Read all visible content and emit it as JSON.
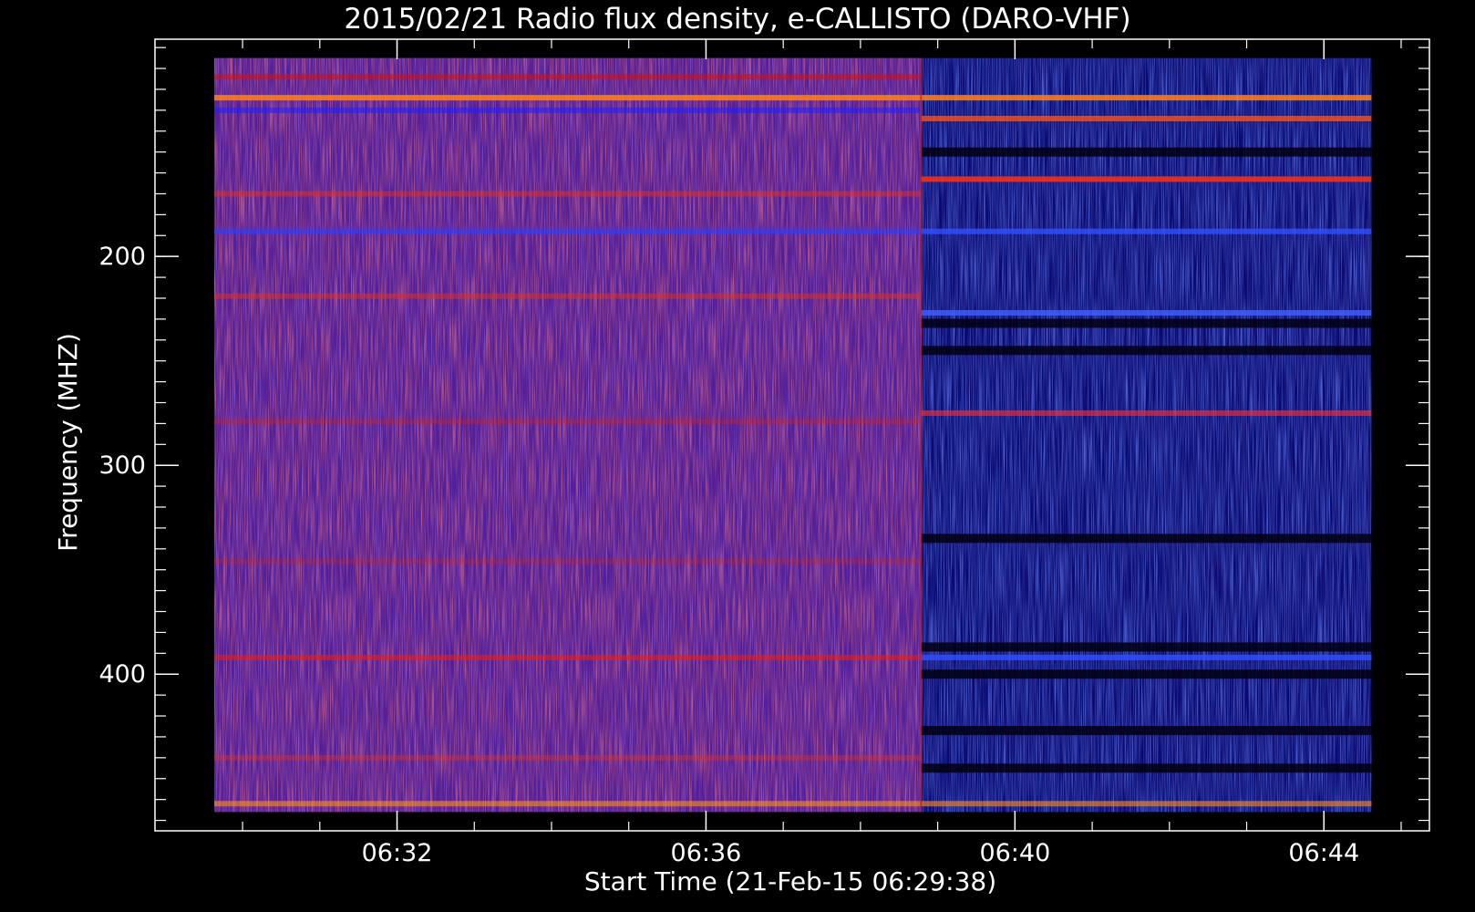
{
  "chart_data": {
    "type": "heatmap",
    "title": "2015/02/21  Radio flux density, e-CALLISTO (DARO-VHF)",
    "xlabel": "Start Time (21-Feb-15 06:29:38)",
    "ylabel": "Frequency (MHZ)",
    "x_ticks": [
      "06:32",
      "06:36",
      "06:40",
      "06:44"
    ],
    "x_tick_minutes": [
      2.367,
      6.367,
      10.367,
      14.367
    ],
    "y_ticks": [
      200,
      300,
      400
    ],
    "xlim_minutes": [
      -0.767,
      15.733
    ],
    "ylim": [
      475,
      96
    ],
    "data_extent": {
      "time_minutes": [
        0,
        14.983
      ],
      "frequency_mhz": [
        105,
        466
      ],
      "change_point_minutes": 9.15
    },
    "segments": [
      {
        "time_minutes": [
          0,
          9.15
        ],
        "background": "#52209a"
      },
      {
        "time_minutes": [
          9.15,
          14.983
        ],
        "background": "#0a0a70"
      }
    ],
    "bands": [
      {
        "freq": 114,
        "t": [
          0,
          9.15
        ],
        "color": "#d01010",
        "opacity": 0.55
      },
      {
        "freq": 124,
        "t": [
          0,
          14.983
        ],
        "color": "#ff8020",
        "opacity": 0.85
      },
      {
        "freq": 130,
        "t": [
          0,
          9.15
        ],
        "color": "#2020ff",
        "opacity": 0.6
      },
      {
        "freq": 134,
        "t": [
          9.15,
          14.983
        ],
        "color": "#ff5010",
        "opacity": 0.8
      },
      {
        "freq": 163,
        "t": [
          9.15,
          14.983
        ],
        "color": "#ff3010",
        "opacity": 0.85
      },
      {
        "freq": 170,
        "t": [
          0,
          9.15
        ],
        "color": "#e03020",
        "opacity": 0.5
      },
      {
        "freq": 188,
        "t": [
          0,
          9.15
        ],
        "color": "#2a40ff",
        "opacity": 0.6
      },
      {
        "freq": 188,
        "t": [
          9.15,
          14.983
        ],
        "color": "#3050ff",
        "opacity": 0.8
      },
      {
        "freq": 219,
        "t": [
          0,
          9.15
        ],
        "color": "#e03020",
        "opacity": 0.5
      },
      {
        "freq": 227,
        "t": [
          9.15,
          14.983
        ],
        "color": "#4060ff",
        "opacity": 0.8
      },
      {
        "freq": 279,
        "t": [
          0,
          9.15
        ],
        "color": "#d02020",
        "opacity": 0.35
      },
      {
        "freq": 275,
        "t": [
          9.15,
          14.983
        ],
        "color": "#ff3030",
        "opacity": 0.6
      },
      {
        "freq": 346,
        "t": [
          0,
          9.15
        ],
        "color": "#d02020",
        "opacity": 0.3
      },
      {
        "freq": 392,
        "t": [
          0,
          9.15
        ],
        "color": "#e02020",
        "opacity": 0.6
      },
      {
        "freq": 392,
        "t": [
          9.15,
          14.983
        ],
        "color": "#3050ff",
        "opacity": 0.8
      },
      {
        "freq": 440,
        "t": [
          0,
          9.15
        ],
        "color": "#e03020",
        "opacity": 0.4
      },
      {
        "freq": 462,
        "t": [
          0,
          14.983
        ],
        "color": "#ff9020",
        "opacity": 0.6
      }
    ],
    "dark_bands": [
      {
        "freq": 150,
        "t": [
          9.15,
          14.983
        ]
      },
      {
        "freq": 232,
        "t": [
          9.15,
          14.983
        ]
      },
      {
        "freq": 245,
        "t": [
          9.15,
          14.983
        ]
      },
      {
        "freq": 335,
        "t": [
          9.15,
          14.983
        ]
      },
      {
        "freq": 387,
        "t": [
          9.15,
          14.983
        ]
      },
      {
        "freq": 400,
        "t": [
          9.15,
          14.983
        ]
      },
      {
        "freq": 427,
        "t": [
          9.15,
          14.983
        ]
      },
      {
        "freq": 445,
        "t": [
          9.15,
          14.983
        ]
      }
    ],
    "colors": {
      "background": "#000000",
      "axis": "#ffffff",
      "low": "#0a0a70",
      "mid": "#52209a",
      "high": "#ff3010",
      "peak": "#ffe040"
    }
  }
}
